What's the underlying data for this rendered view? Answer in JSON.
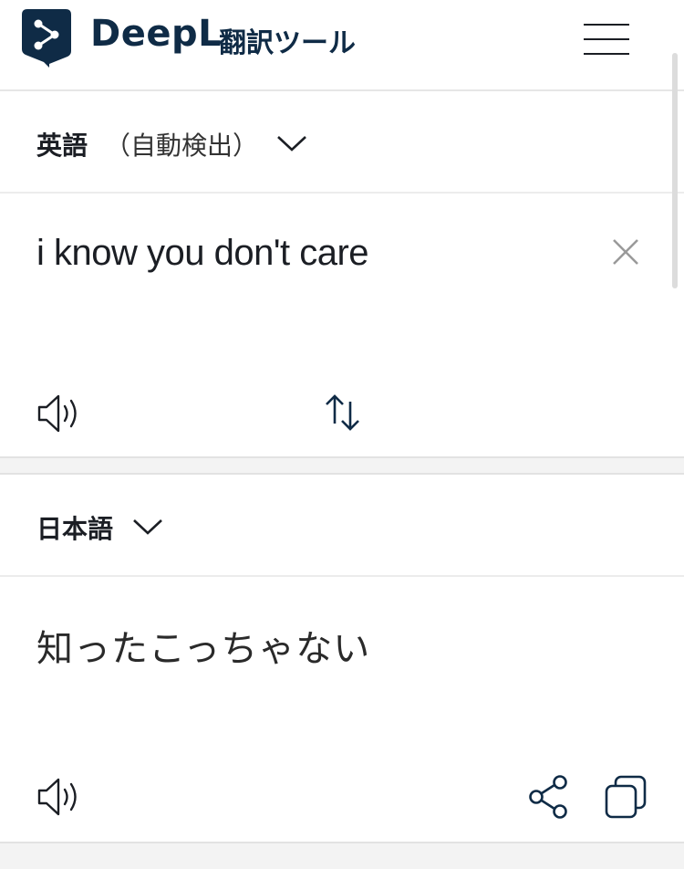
{
  "header": {
    "brand_name": "DeepL",
    "brand_sub": "翻訳ツール",
    "brand_color": "#0f2b46"
  },
  "source": {
    "language": "英語",
    "auto_detect": "（自動検出）",
    "text": "i know you don't care",
    "icons": [
      "chevron-down-icon",
      "clear-icon",
      "speaker-icon",
      "swap-icon"
    ]
  },
  "target": {
    "language": "日本語",
    "text": "知ったこっちゃない",
    "icons": [
      "chevron-down-icon",
      "speaker-icon",
      "share-icon",
      "copy-icon"
    ]
  }
}
